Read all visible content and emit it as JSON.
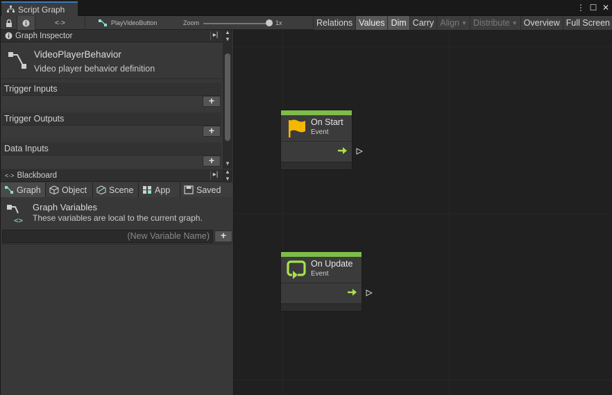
{
  "window": {
    "tab_title": "Script Graph",
    "controls": {
      "menu": "⋮",
      "maximize": "☐",
      "close": "✕"
    }
  },
  "toolbar": {
    "lock_icon": "lock-icon",
    "info_icon": "info-icon",
    "code_icon": "code-brackets-icon",
    "graph_name": "PlayVideoButton",
    "zoom_label": "Zoom",
    "zoom_value": "1x",
    "zoom_level": 1.0,
    "buttons": [
      {
        "label": "Relations",
        "state": "normal"
      },
      {
        "label": "Values",
        "state": "active"
      },
      {
        "label": "Dim",
        "state": "active"
      },
      {
        "label": "Carry",
        "state": "normal"
      },
      {
        "label": "Align",
        "state": "disabled",
        "dropdown": true
      },
      {
        "label": "Distribute",
        "state": "disabled",
        "dropdown": true
      },
      {
        "label": "Overview",
        "state": "normal"
      },
      {
        "label": "Full Screen",
        "state": "normal"
      }
    ]
  },
  "inspector": {
    "header": "Graph Inspector",
    "title": "VideoPlayerBehavior",
    "subtitle": "Video player behavior definition",
    "sections": [
      {
        "label": "Trigger Inputs",
        "add": "+"
      },
      {
        "label": "Trigger Outputs",
        "add": "+"
      },
      {
        "label": "Data Inputs",
        "add": "+"
      }
    ]
  },
  "blackboard": {
    "header": "Blackboard",
    "tabs": [
      {
        "label": "Graph",
        "icon": "graph-icon"
      },
      {
        "label": "Object",
        "icon": "cube-icon"
      },
      {
        "label": "Scene",
        "icon": "scene-icon"
      },
      {
        "label": "App",
        "icon": "app-icon"
      },
      {
        "label": "Saved",
        "icon": "save-icon"
      }
    ],
    "title": "Graph Variables",
    "subtitle": "These variables are local to the current graph.",
    "new_variable_placeholder": "(New Variable Name)",
    "add": "+"
  },
  "nodes": [
    {
      "title": "On Start",
      "kind": "Event",
      "icon": "flag-icon"
    },
    {
      "title": "On Update",
      "kind": "Event",
      "icon": "loop-icon"
    }
  ],
  "colors": {
    "accent_tab": "#3a7ac2",
    "event_bar": "#7dbd4a",
    "flag": "#f5b800",
    "flow_arrow": "#a7e24a"
  }
}
